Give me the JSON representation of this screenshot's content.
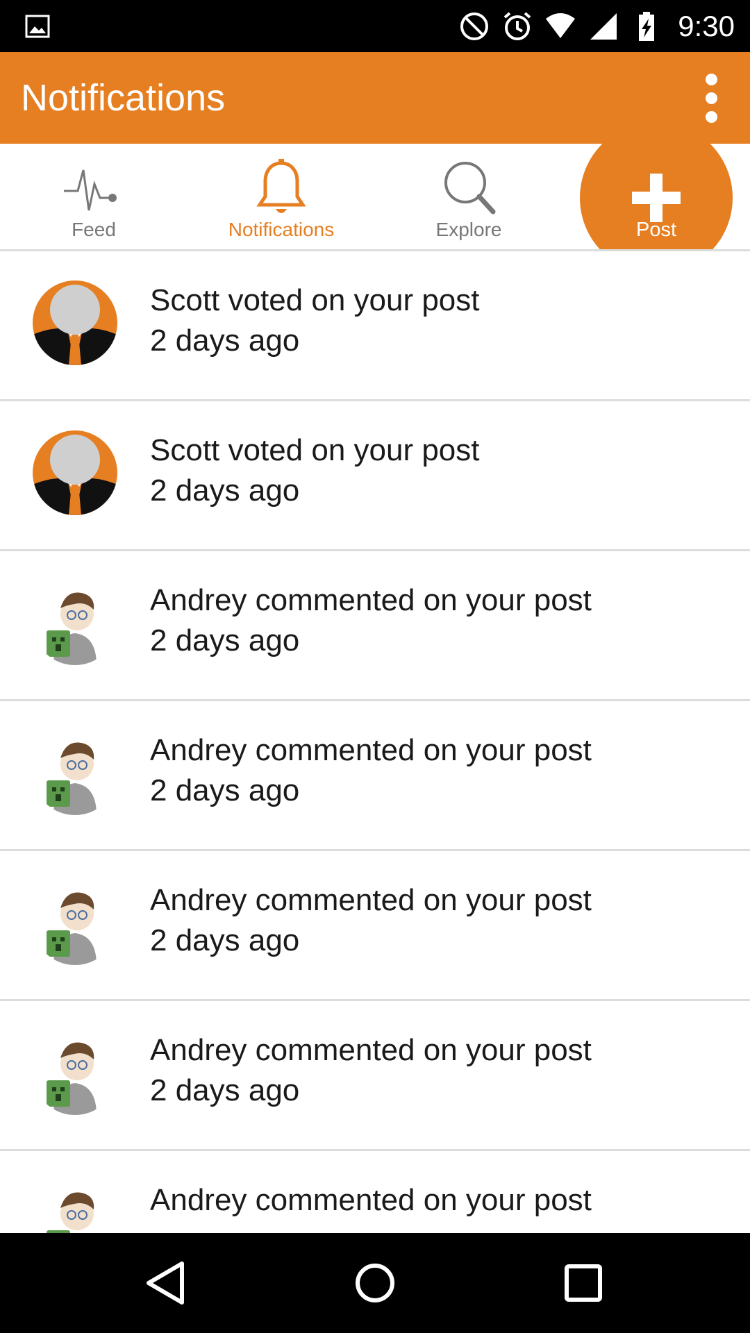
{
  "status_bar": {
    "time": "9:30",
    "icons": [
      "image-icon",
      "do-not-disturb-icon",
      "alarm-icon",
      "wifi-icon",
      "signal-icon",
      "battery-charging-icon"
    ]
  },
  "app_bar": {
    "title": "Notifications",
    "overflow_icon": "more-vert-icon"
  },
  "tabs": [
    {
      "label": "Feed",
      "icon": "pulse-icon",
      "active": false
    },
    {
      "label": "Notifications",
      "icon": "bell-icon",
      "active": true
    },
    {
      "label": "Explore",
      "icon": "search-icon",
      "active": false
    },
    {
      "label": "Post",
      "icon": "plus-icon",
      "active": false
    }
  ],
  "notifications": [
    {
      "user": "Scott",
      "avatar": "suit-avatar",
      "message": "Scott voted on your post",
      "time": "2 days ago"
    },
    {
      "user": "Scott",
      "avatar": "suit-avatar",
      "message": "Scott voted on your post",
      "time": "2 days ago"
    },
    {
      "user": "Andrey",
      "avatar": "cartoon-avatar",
      "message": "Andrey commented on your post",
      "time": "2 days ago"
    },
    {
      "user": "Andrey",
      "avatar": "cartoon-avatar",
      "message": "Andrey commented on your post",
      "time": "2 days ago"
    },
    {
      "user": "Andrey",
      "avatar": "cartoon-avatar",
      "message": "Andrey commented on your post",
      "time": "2 days ago"
    },
    {
      "user": "Andrey",
      "avatar": "cartoon-avatar",
      "message": "Andrey commented on your post",
      "time": "2 days ago"
    },
    {
      "user": "Andrey",
      "avatar": "cartoon-avatar",
      "message": "Andrey commented on your post",
      "time": ""
    }
  ],
  "nav_bar": {
    "icons": [
      "back-icon",
      "home-icon",
      "recents-icon"
    ]
  },
  "colors": {
    "accent": "#e67e22",
    "inactive": "#777777",
    "divider": "#dcdcdc"
  }
}
